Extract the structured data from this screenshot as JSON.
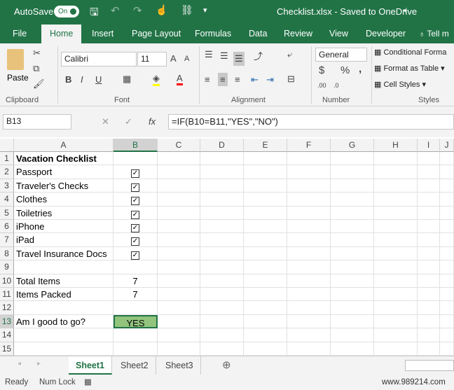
{
  "title_bar": {
    "autosave_label": "AutoSave",
    "autosave_state": "On",
    "doc_title": "Checklist.xlsx  -  Saved to OneDrive"
  },
  "tabs": [
    "File",
    "Home",
    "Insert",
    "Page Layout",
    "Formulas",
    "Data",
    "Review",
    "View",
    "Developer",
    "Tell m"
  ],
  "ribbon": {
    "paste_label": "Paste",
    "clipboard_label": "Clipboard",
    "font_name": "Calibri",
    "font_size": "11",
    "font_label": "Font",
    "bold": "B",
    "italic": "I",
    "underline": "U",
    "font_color_letter": "A",
    "alignment_label": "Alignment",
    "number_format": "General",
    "number_label": "Number",
    "currency": "$",
    "percent": "%",
    "comma": ",",
    "conditional": "Conditional Forma",
    "format_table": "Format as Table",
    "cell_styles": "Cell Styles",
    "styles_label": "Styles",
    "highlight_color": "#ffff00",
    "font_color": "#ff0000"
  },
  "formula_bar": {
    "name_box": "B13",
    "fx": "fx",
    "formula": "=IF(B10=B11,\"YES\",\"NO\")"
  },
  "columns": [
    "A",
    "B",
    "C",
    "D",
    "E",
    "F",
    "G",
    "H",
    "I",
    "J"
  ],
  "rows": [
    {
      "n": "1",
      "a": "Vacation Checklist",
      "b": "",
      "bold": true
    },
    {
      "n": "2",
      "a": "Passport",
      "b": "check"
    },
    {
      "n": "3",
      "a": "Traveler's Checks",
      "b": "check"
    },
    {
      "n": "4",
      "a": "Clothes",
      "b": "check"
    },
    {
      "n": "5",
      "a": "Toiletries",
      "b": "check"
    },
    {
      "n": "6",
      "a": "iPhone",
      "b": "check"
    },
    {
      "n": "7",
      "a": "iPad",
      "b": "check"
    },
    {
      "n": "8",
      "a": "Travel Insurance Docs",
      "b": "check"
    },
    {
      "n": "9",
      "a": "",
      "b": ""
    },
    {
      "n": "10",
      "a": "Total Items",
      "b": "7"
    },
    {
      "n": "11",
      "a": "Items Packed",
      "b": "7"
    },
    {
      "n": "12",
      "a": "",
      "b": ""
    },
    {
      "n": "13",
      "a": "Am I good to go?",
      "b": "YES",
      "selected": true
    },
    {
      "n": "14",
      "a": "",
      "b": ""
    },
    {
      "n": "15",
      "a": "",
      "b": ""
    }
  ],
  "sheets": [
    "Sheet1",
    "Sheet2",
    "Sheet3"
  ],
  "status": {
    "ready": "Ready",
    "numlock": "Num Lock"
  },
  "watermark": "www.989214.com",
  "colors": {
    "brand": "#217346",
    "yes_fill": "#92c47d"
  }
}
